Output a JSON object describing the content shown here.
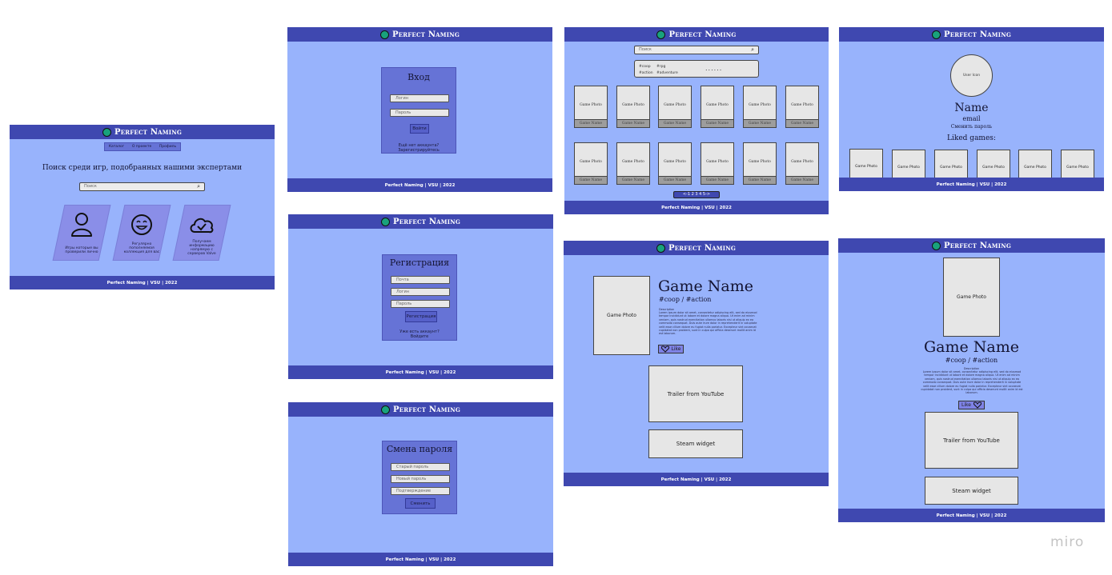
{
  "brand": {
    "name": "Perfect Naming",
    "logo_color": "#19a27c",
    "header_color": "#3f48b0",
    "page_color": "#98b3fc",
    "footer_text": "Perfect Naming | VSU | 2022"
  },
  "home": {
    "nav": [
      "Каталог",
      "О проекте",
      "Профиль"
    ],
    "heading": "Поиск среди игр, подобранных нашими экспертами",
    "search_placeholder": "Поиск",
    "features": [
      {
        "icon": "user-icon",
        "text": "Игры которые вы проверили лично"
      },
      {
        "icon": "smile-icon",
        "text": "Регулярно пополняемая коллекция для вас"
      },
      {
        "icon": "cloud-check-icon",
        "text": "Получаем информацию напрямую с серверов Valve"
      }
    ]
  },
  "login": {
    "title": "Вход",
    "login_placeholder": "Логин",
    "password_placeholder": "Пароль",
    "submit": "Войти",
    "note_line1": "Ещё нет аккаунта?",
    "note_line2": "Зарегистрируйтесь"
  },
  "register": {
    "title": "Регистрация",
    "email_placeholder": "Почта",
    "login_placeholder": "Логин",
    "password_placeholder": "Пароль",
    "submit": "Регистрация",
    "note_line1": "Уже есть аккаунт?",
    "note_line2": "Войдите"
  },
  "change_password": {
    "title": "Смена пароля",
    "old_placeholder": "Старый пароль",
    "new_placeholder": "Новый пароль",
    "confirm_placeholder": "Подтверждение",
    "submit": "Сменить"
  },
  "catalog": {
    "search_placeholder": "Поиск",
    "tags": [
      "#coop",
      "#rpg",
      "#action",
      "#adventure"
    ],
    "dots": "......",
    "card_photo": "Game Photo",
    "card_name": "Game Name",
    "pagination": "<-1 2 3 4 5->"
  },
  "profile": {
    "user_icon": "User Icon",
    "name": "Name",
    "email": "email",
    "change_password": "Сменить пароль",
    "liked_games": "Liked games:",
    "card_photo": "Game Photo"
  },
  "game_page": {
    "photo": "Game Photo",
    "name": "Game Name",
    "tags": "#coop / #action",
    "description_label": "Description",
    "description": "Lorem ipsum dolor sit amet, consectetur adipiscing elit, sed do eiusmod tempor incididunt ut labore et dolore magna aliqua. Ut enim ad minim veniam, quis nostrud exercitation ullamco laboris nisi ut aliquip ex ea commodo consequat. Duis aute irure dolor in reprehenderit in voluptate velit esse cillum dolore eu fugiat nulla pariatur. Excepteur sint occaecat cupidatat non proident, sunt in culpa qui officia deserunt mollit anim id est laborum.",
    "like": "Like",
    "trailer": "Trailer from YouTube",
    "steam": "Steam widget"
  },
  "watermark": "miro"
}
